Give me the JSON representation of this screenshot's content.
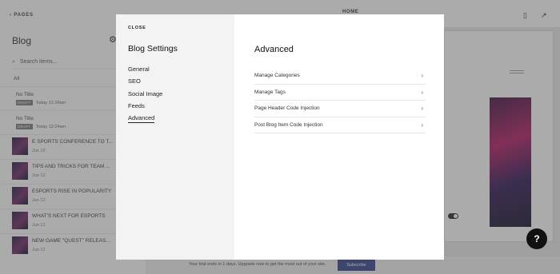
{
  "sidebar": {
    "back_label": "PAGES",
    "title": "Blog",
    "search_placeholder": "Search items...",
    "filter_label": "All",
    "drafts": [
      {
        "title": "No Title",
        "badge": "DRAFT",
        "time": "Today 12:24am"
      },
      {
        "title": "No Title",
        "badge": "DRAFT",
        "time": "Today 12:24am"
      }
    ],
    "posts": [
      {
        "title": "E SPORTS CONFERENCE TO T...",
        "date": "Jun 16"
      },
      {
        "title": "TIPS AND TRICKS FOR TEAM ...",
        "date": "Jun 12"
      },
      {
        "title": "ESPORTS RISE IN POPULARITY",
        "date": "Jun 12"
      },
      {
        "title": "WHAT'S NEXT FOR ESPORTS",
        "date": "Jun 12"
      },
      {
        "title": "NEW GAME \"QUEST\" RELEAS...",
        "date": "Jun 12"
      }
    ]
  },
  "topbar": {
    "page_label": "HOME"
  },
  "trial": {
    "text": "Your trial ends in 1 days. Upgrade now to get the most out of your site.",
    "subscribe_label": "Subscribe"
  },
  "help": {
    "label": "?"
  },
  "modal": {
    "close_label": "CLOSE",
    "title": "Blog Settings",
    "nav": [
      {
        "label": "General",
        "active": false
      },
      {
        "label": "SEO",
        "active": false
      },
      {
        "label": "Social Image",
        "active": false
      },
      {
        "label": "Feeds",
        "active": false
      },
      {
        "label": "Advanced",
        "active": true
      }
    ],
    "section_title": "Advanced",
    "items": [
      {
        "label": "Manage Categories"
      },
      {
        "label": "Manage Tags"
      },
      {
        "label": "Page Header Code Injection"
      },
      {
        "label": "Post Blog Item Code Injection"
      }
    ]
  },
  "colors": {
    "subscribe_bg": "#2d3f8a",
    "overlay": "rgba(80,80,80,0.48)"
  },
  "icons": [
    "chevron-left-icon",
    "search-icon",
    "gear-icon",
    "mobile-icon",
    "external-link-icon",
    "chevron-right-icon",
    "help-icon"
  ]
}
